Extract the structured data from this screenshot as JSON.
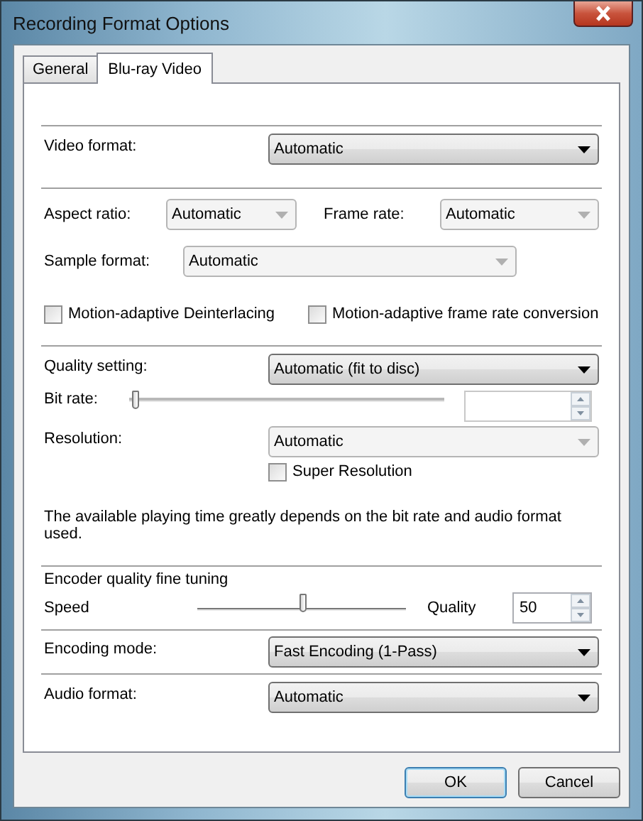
{
  "window": {
    "title": "Recording Format Options"
  },
  "tabs": [
    {
      "label": "General",
      "selected": false
    },
    {
      "label": "Blu-ray Video",
      "selected": true
    }
  ],
  "video_format": {
    "label": "Video format:",
    "value": "Automatic",
    "disabled": false
  },
  "aspect_ratio": {
    "label": "Aspect ratio:",
    "value": "Automatic",
    "disabled": true
  },
  "frame_rate": {
    "label": "Frame rate:",
    "value": "Automatic",
    "disabled": true
  },
  "sample_format": {
    "label": "Sample format:",
    "value": "Automatic",
    "disabled": true
  },
  "checkboxes": [
    {
      "label": "Motion-adaptive Deinterlacing",
      "checked": false
    },
    {
      "label": "Motion-adaptive frame rate conversion",
      "checked": false
    }
  ],
  "quality_setting": {
    "label": "Quality setting:",
    "value": "Automatic (fit to disc)",
    "disabled": false
  },
  "bit_rate": {
    "label": "Bit rate:",
    "level": 0
  },
  "resolution": {
    "label": "Resolution:",
    "value": "Automatic",
    "disabled": true
  },
  "super_resolution": {
    "label": "Super Resolution",
    "checked": false
  },
  "note": "The available playing time greatly depends on the bit rate and audio format used.",
  "fine_tuning": {
    "title": "Encoder quality fine tuning",
    "left_label": "Speed",
    "right_label": "Quality",
    "level": 0.5,
    "value": "50"
  },
  "encoding_mode": {
    "label": "Encoding mode:",
    "value": "Fast Encoding (1-Pass)",
    "disabled": false
  },
  "audio_format": {
    "label": "Audio format:",
    "value": "Automatic",
    "disabled": false
  },
  "buttons": [
    {
      "label": "OK",
      "default": true
    },
    {
      "label": "Cancel",
      "default": false
    }
  ]
}
